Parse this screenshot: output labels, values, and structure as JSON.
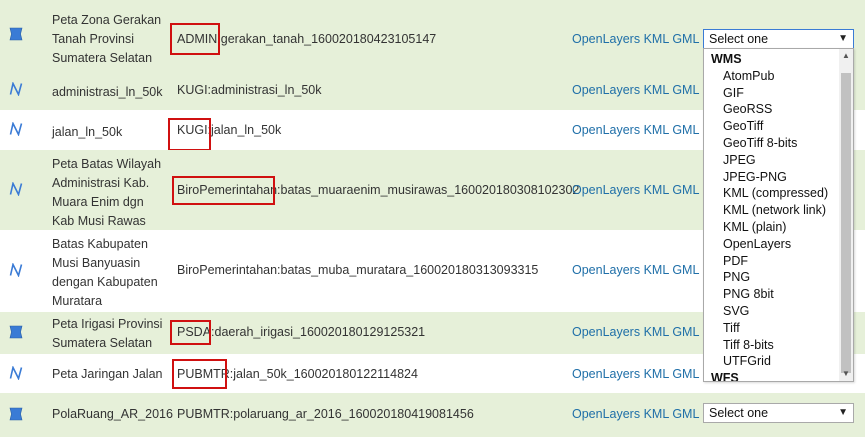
{
  "rows": [
    {
      "type": "polygon",
      "title_lines": [
        "Peta Zona Gerakan",
        "Tanah Provinsi",
        "Sumatera Selatan"
      ],
      "name": "ADMIN:gerakan_tanah_160020180423105147",
      "links": [
        "OpenLayers",
        "KML",
        "GML"
      ],
      "select_value": "Select one"
    },
    {
      "type": "line",
      "title_lines": [
        "administrasi_ln_50k"
      ],
      "name": "KUGI:administrasi_ln_50k",
      "links": [
        "OpenLayers",
        "KML",
        "GML"
      ]
    },
    {
      "type": "line",
      "title_lines": [
        "jalan_ln_50k"
      ],
      "name": "KUGI:jalan_ln_50k",
      "links": [
        "OpenLayers",
        "KML",
        "GML"
      ]
    },
    {
      "type": "line",
      "title_lines": [
        "Peta Batas Wilayah",
        "Administrasi Kab.",
        "Muara Enim dgn",
        "Kab Musi Rawas"
      ],
      "name": "BiroPemerintahan:batas_muaraenim_musirawas_160020180308102302",
      "links": [
        "OpenLayers",
        "KML",
        "GML"
      ]
    },
    {
      "type": "line",
      "title_lines": [
        "Batas Kabupaten",
        "Musi Banyuasin",
        "dengan Kabupaten",
        "Muratara"
      ],
      "name": "BiroPemerintahan:batas_muba_muratara_160020180313093315",
      "links": [
        "OpenLayers",
        "KML",
        "GML"
      ]
    },
    {
      "type": "polygon",
      "title_lines": [
        "Peta Irigasi Provinsi",
        "Sumatera Selatan"
      ],
      "name": "PSDA:daerah_irigasi_160020180129125321",
      "links": [
        "OpenLayers",
        "KML",
        "GML"
      ]
    },
    {
      "type": "line",
      "title_lines": [
        "Peta Jaringan Jalan"
      ],
      "name": "PUBMTR:jalan_50k_160020180122114824",
      "links": [
        "OpenLayers",
        "KML",
        "GML"
      ]
    },
    {
      "type": "polygon",
      "title_lines": [
        "PolaRuang_AR_2016"
      ],
      "name": "PUBMTR:polaruang_ar_2016_160020180419081456",
      "links": [
        "OpenLayers",
        "KML",
        "GML"
      ],
      "select_value": "Select one"
    }
  ],
  "dropdown": {
    "groups": [
      {
        "label": "WMS",
        "options": [
          "AtomPub",
          "GIF",
          "GeoRSS",
          "GeoTiff",
          "GeoTiff 8-bits",
          "JPEG",
          "JPEG-PNG",
          "KML (compressed)",
          "KML (network link)",
          "KML (plain)",
          "OpenLayers",
          "PDF",
          "PNG",
          "PNG 8bit",
          "SVG",
          "Tiff",
          "Tiff 8-bits",
          "UTFGrid"
        ]
      },
      {
        "label": "WFS",
        "options": []
      }
    ]
  },
  "colors": {
    "row_alt": "#e6f0d9",
    "link": "#1f6fa8",
    "highlight_box": "#d01010",
    "icon": "#3a7bd5"
  }
}
